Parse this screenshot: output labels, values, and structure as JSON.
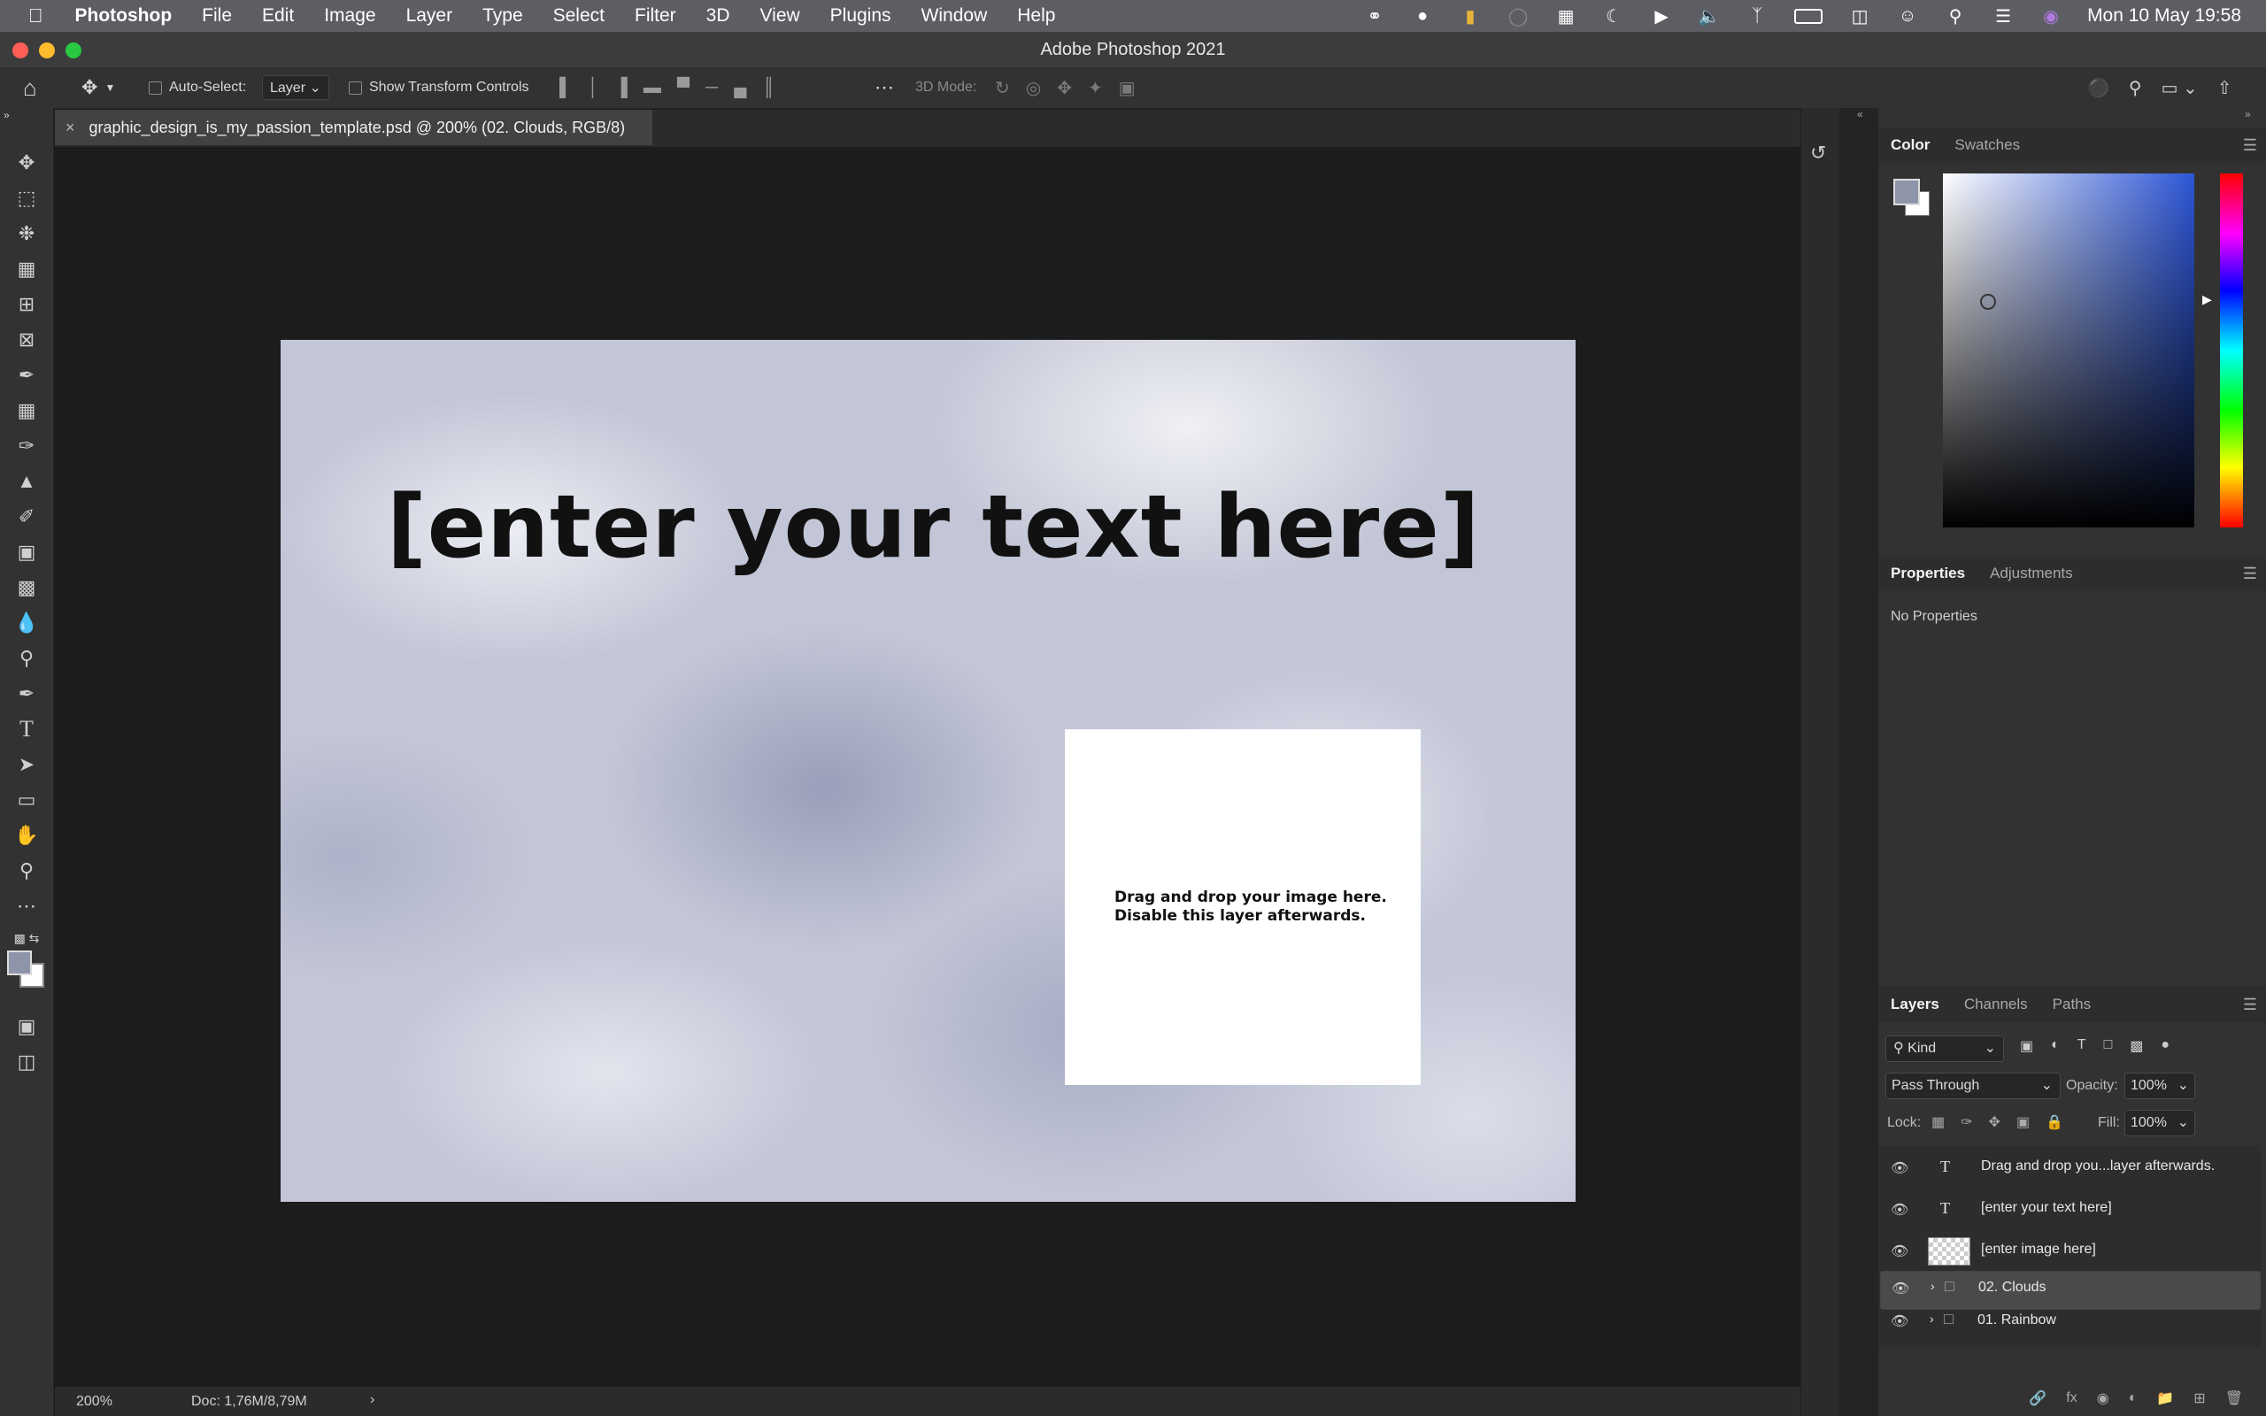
{
  "menubar": {
    "app_name": "Photoshop",
    "items": [
      "File",
      "Edit",
      "Image",
      "Layer",
      "Type",
      "Select",
      "Filter",
      "3D",
      "View",
      "Plugins",
      "Window",
      "Help"
    ],
    "clock": "Mon 10 May  19:58"
  },
  "window": {
    "title": "Adobe Photoshop 2021"
  },
  "options": {
    "auto_select_label": "Auto-Select:",
    "auto_select_value": "Layer",
    "show_transform_label": "Show Transform Controls",
    "mode_label": "3D Mode:"
  },
  "document": {
    "tab_title": "graphic_design_is_my_passion_template.psd @ 200% (02. Clouds, RGB/8)",
    "headline": "[enter your text here]",
    "drop_line1": "Drag and drop your image here.",
    "drop_line2": "Disable this layer afterwards."
  },
  "status": {
    "zoom": "200%",
    "doc_size": "Doc: 1,76M/8,79M"
  },
  "color_panel": {
    "tabs": [
      "Color",
      "Swatches"
    ],
    "foreground": "#8e95a9",
    "background": "#ffffff"
  },
  "properties_panel": {
    "tabs": [
      "Properties",
      "Adjustments"
    ],
    "empty_text": "No Properties"
  },
  "layers_panel": {
    "tabs": [
      "Layers",
      "Channels",
      "Paths"
    ],
    "filter_kind": "Kind",
    "blend_mode": "Pass Through",
    "opacity_label": "Opacity:",
    "opacity_value": "100%",
    "lock_label": "Lock:",
    "fill_label": "Fill:",
    "fill_value": "100%",
    "layers": [
      {
        "name": "Drag and drop you...layer afterwards.",
        "kind": "text"
      },
      {
        "name": "[enter your text here]",
        "kind": "text"
      },
      {
        "name": "[enter image here]",
        "kind": "pixel"
      },
      {
        "name": "02. Clouds",
        "kind": "group",
        "selected": true
      },
      {
        "name": "01. Rainbow",
        "kind": "group"
      }
    ]
  }
}
